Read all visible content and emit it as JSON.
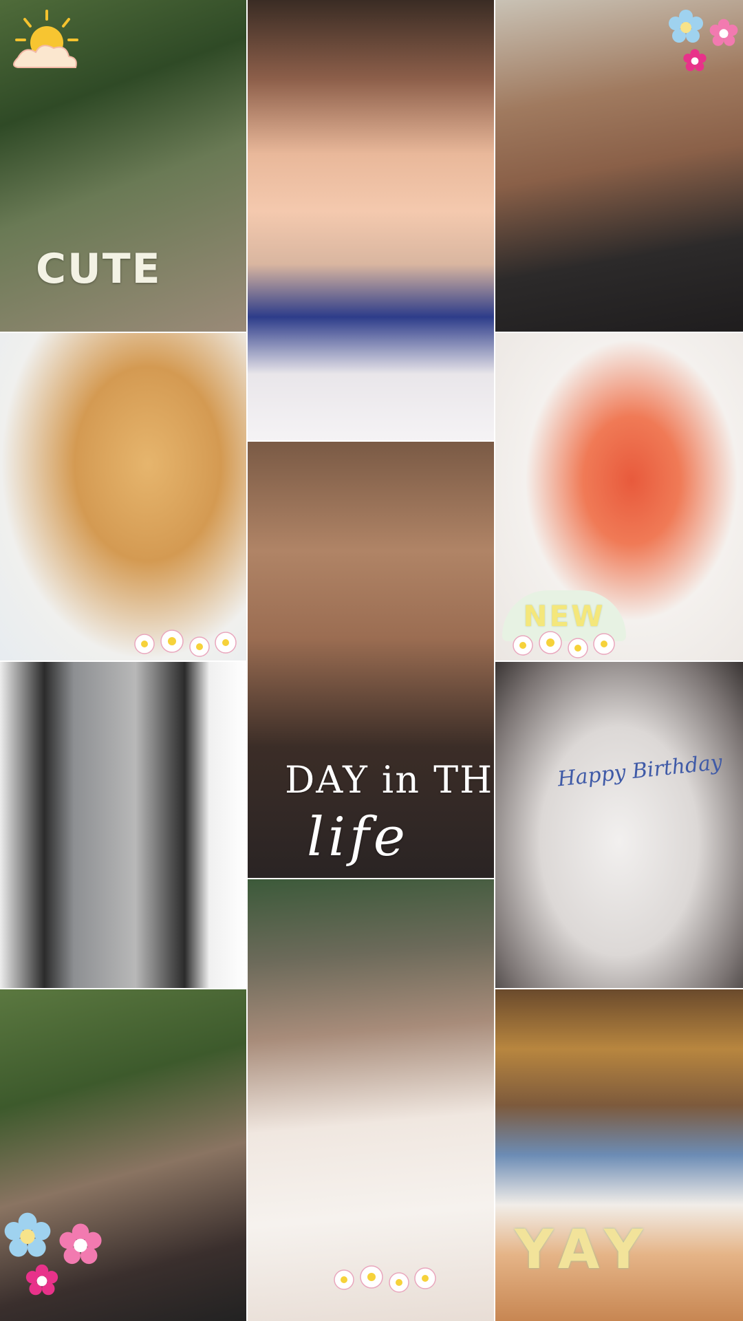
{
  "captions": {
    "cute": "CUTE",
    "day_in_the": "DAY in THE",
    "life": "life",
    "new": "NEW",
    "happy_birthday": "Happy Birthday",
    "yay": "YAY"
  },
  "stickers": {
    "sun": "sun-with-cloud-icon",
    "flower": "flower-icon",
    "daisy_row": "daisy-cluster-icon"
  },
  "colors": {
    "cute_text": "#f3f2e4",
    "new_badge": "#e7f2e3",
    "new_text": "#f4e77b",
    "birthday_text": "#3f5aa7",
    "yay_text": "#f2e39a",
    "flower_pink": "#f27ab0",
    "flower_blue": "#9fd2ef",
    "flower_magenta": "#e8328a"
  }
}
